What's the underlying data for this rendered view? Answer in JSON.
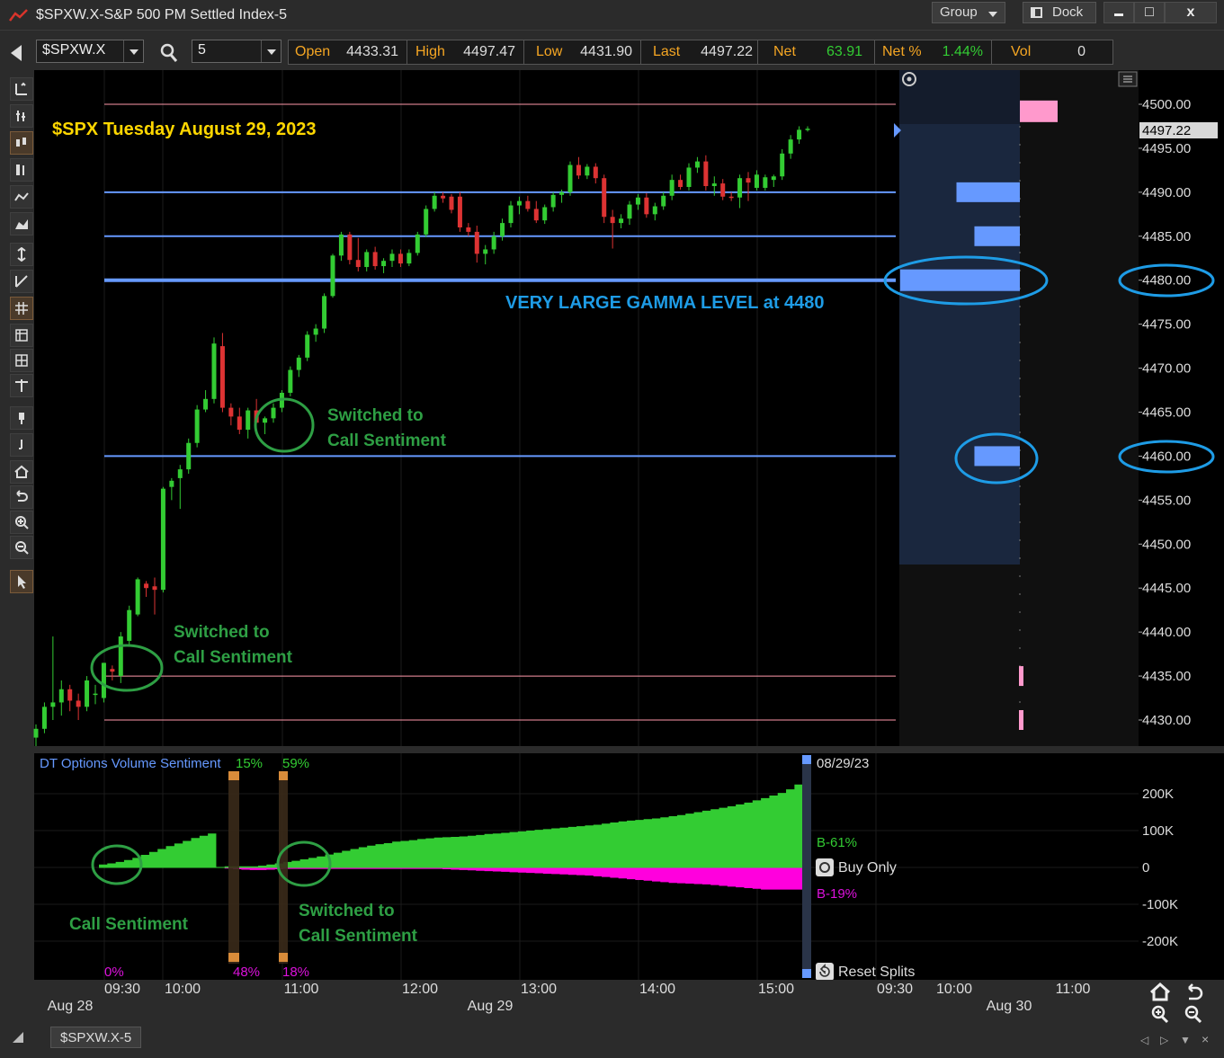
{
  "window": {
    "title": "$SPXW.X-S&P 500 PM Settled Index-5",
    "group_label": "Group",
    "dock_label": "Dock",
    "min_glyph": "▬",
    "max_glyph": "□",
    "close_glyph": "x"
  },
  "toolbar": {
    "symbol": "$SPXW.X",
    "interval": "5",
    "quote": [
      {
        "label": "Open",
        "value": "4433.31",
        "color": "#dddddd"
      },
      {
        "label": "High",
        "value": "4497.47",
        "color": "#dddddd"
      },
      {
        "label": "Low",
        "value": "4431.90",
        "color": "#dddddd"
      },
      {
        "label": "Last",
        "value": "4497.22",
        "color": "#dddddd"
      },
      {
        "label": "Net",
        "value": "63.91",
        "color": "#33cc33"
      },
      {
        "label": "Net %",
        "value": "1.44%",
        "color": "#33cc33"
      },
      {
        "label": "Vol",
        "value": "0",
        "color": "#dddddd"
      }
    ]
  },
  "footer": {
    "tab_label": "$SPXW.X-5"
  },
  "annotations": {
    "headline": "$SPX Tuesday August 29, 2023",
    "gamma_note": "VERY LARGE GAMMA LEVEL at 4480",
    "switch_upper": [
      "Switched to",
      "Call Sentiment"
    ],
    "switch_lower": [
      "Switched to",
      "Call Sentiment"
    ],
    "sentiment_start": "Call Sentiment",
    "sentiment_switch": [
      "Switched to",
      "Call Sentiment"
    ]
  },
  "price_axis": {
    "ticks": [
      "4500.00",
      "4495.00",
      "4490.00",
      "4485.00",
      "4480.00",
      "4475.00",
      "4470.00",
      "4465.00",
      "4460.00",
      "4455.00",
      "4450.00",
      "4445.00",
      "4440.00",
      "4435.00",
      "4430.00"
    ],
    "last_label": "4497.22"
  },
  "time_axis": {
    "times": [
      "09:30",
      "10:00",
      "11:00",
      "12:00",
      "13:00",
      "14:00",
      "15:00",
      "09:30",
      "10:00",
      "11:00"
    ],
    "dates": [
      "Aug 28",
      "Aug 29",
      "Aug 30"
    ]
  },
  "indicator": {
    "title": "DT Options Volume Sentiment",
    "top_pct_1": "15%",
    "top_pct_2": "59%",
    "bottom_pct_0": "0%",
    "bottom_pct_1": "48%",
    "bottom_pct_2": "18%",
    "date": "08/29/23",
    "buy_label": "B-61%",
    "sell_label": "B-19%",
    "buy_only": "Buy Only",
    "reset_splits": "Reset Splits",
    "axis": [
      "200K",
      "100K",
      "0",
      "-100K",
      "-200K"
    ]
  },
  "chart_data": [
    {
      "type": "candlestick",
      "title": "$SPX Tuesday August 29, 2023",
      "ylim": [
        4428,
        4503
      ],
      "gamma_levels": [
        4500,
        4490,
        4485,
        4480,
        4460,
        4435,
        4430
      ],
      "gamma_bars": [
        {
          "price": 4498,
          "size": 0.28,
          "color": "#ff99cc"
        },
        {
          "price": 4490,
          "size": 0.53,
          "color": "#6699ff"
        },
        {
          "price": 4485,
          "size": 0.38,
          "color": "#6699ff"
        },
        {
          "price": 4480,
          "size": 1.0,
          "color": "#6699ff"
        },
        {
          "price": 4460,
          "size": 0.38,
          "color": "#6699ff"
        },
        {
          "price": 4435,
          "size": 0.03,
          "color": "#ff99cc"
        },
        {
          "price": 4430,
          "size": 0.02,
          "color": "#ff99cc"
        }
      ],
      "candles": [
        [
          4428.0,
          4429.5,
          4427.0,
          4429.0
        ],
        [
          4429.0,
          4432.0,
          4428.5,
          4431.5
        ],
        [
          4431.5,
          4439.5,
          4430.0,
          4432.0
        ],
        [
          4432.0,
          4434.5,
          4430.5,
          4433.5
        ],
        [
          4433.5,
          4434.0,
          4431.0,
          4432.2
        ],
        [
          4432.2,
          4433.0,
          4430.0,
          4431.5
        ],
        [
          4431.5,
          4435.0,
          4431.0,
          4434.5
        ],
        [
          4433.0,
          4434.0,
          4431.8,
          4433.0
        ],
        [
          4432.5,
          4436.5,
          4432.0,
          4436.5
        ],
        [
          4435.8,
          4436.2,
          4434.5,
          4435.5
        ],
        [
          4435.0,
          4440.0,
          4434.2,
          4439.5
        ],
        [
          4439.0,
          4443.0,
          4438.5,
          4442.5
        ],
        [
          4442.0,
          4446.2,
          4441.8,
          4446.0
        ],
        [
          4445.5,
          4445.8,
          4444.0,
          4445.0
        ],
        [
          4445.2,
          4446.2,
          4442.0,
          4444.8
        ],
        [
          4444.8,
          4456.5,
          4444.5,
          4456.3
        ],
        [
          4456.5,
          4457.5,
          4455.0,
          4457.2
        ],
        [
          4457.5,
          4459.0,
          4454.0,
          4458.5
        ],
        [
          4458.5,
          4462.0,
          4458.0,
          4461.5
        ],
        [
          4461.5,
          4465.8,
          4461.0,
          4465.3
        ],
        [
          4465.3,
          4467.5,
          4465.0,
          4466.5
        ],
        [
          4466.5,
          4473.5,
          4466.0,
          4472.8
        ],
        [
          4472.5,
          4474.0,
          4465.0,
          4465.5
        ],
        [
          4465.5,
          4466.0,
          4463.5,
          4464.5
        ],
        [
          4464.5,
          4465.5,
          4462.5,
          4463.0
        ],
        [
          4463.0,
          4465.5,
          4462.0,
          4465.2
        ],
        [
          4465.2,
          4466.5,
          4463.8,
          4463.8
        ],
        [
          4463.8,
          4464.5,
          4462.5,
          4464.3
        ],
        [
          4464.3,
          4466.0,
          4463.8,
          4465.5
        ],
        [
          4465.5,
          4467.5,
          4465.0,
          4467.2
        ],
        [
          4467.2,
          4470.2,
          4466.8,
          4469.8
        ],
        [
          4469.8,
          4471.5,
          4469.0,
          4471.2
        ],
        [
          4471.2,
          4474.2,
          4470.8,
          4473.8
        ],
        [
          4473.8,
          4475.0,
          4473.0,
          4474.5
        ],
        [
          4474.5,
          4478.5,
          4474.0,
          4478.2
        ],
        [
          4478.2,
          4483.0,
          4478.0,
          4482.8
        ],
        [
          4482.8,
          4485.5,
          4482.2,
          4485.2
        ],
        [
          4485.2,
          4485.5,
          4481.8,
          4482.3
        ],
        [
          4482.3,
          4484.8,
          4481.0,
          4481.5
        ],
        [
          4481.5,
          4483.5,
          4481.0,
          4483.2
        ],
        [
          4483.2,
          4483.8,
          4481.2,
          4481.6
        ],
        [
          4481.6,
          4482.5,
          4480.8,
          4482.2
        ],
        [
          4482.2,
          4483.5,
          4481.5,
          4483.0
        ],
        [
          4483.0,
          4483.5,
          4481.5,
          4481.9
        ],
        [
          4481.9,
          4483.5,
          4481.6,
          4483.1
        ],
        [
          4483.1,
          4485.5,
          4482.8,
          4485.2
        ],
        [
          4485.2,
          4488.5,
          4484.9,
          4488.1
        ],
        [
          4488.1,
          4490.0,
          4487.8,
          4489.6
        ],
        [
          4489.6,
          4490.0,
          4488.8,
          4489.3
        ],
        [
          4489.5,
          4489.8,
          4487.6,
          4488.0
        ],
        [
          4489.5,
          4490.0,
          4485.5,
          4486.0
        ],
        [
          4486.0,
          4486.5,
          4485.0,
          4485.5
        ],
        [
          4485.5,
          4486.2,
          4482.0,
          4483.0
        ],
        [
          4483.0,
          4484.0,
          4481.8,
          4483.5
        ],
        [
          4483.5,
          4485.5,
          4483.0,
          4485.0
        ],
        [
          4485.0,
          4487.0,
          4484.5,
          4486.5
        ],
        [
          4486.5,
          4489.0,
          4486.0,
          4488.5
        ],
        [
          4488.5,
          4489.5,
          4487.5,
          4489.0
        ],
        [
          4489.0,
          4489.6,
          4487.8,
          4488.1
        ],
        [
          4488.1,
          4489.0,
          4486.5,
          4486.8
        ],
        [
          4486.8,
          4488.6,
          4486.4,
          4488.3
        ],
        [
          4488.3,
          4490.0,
          4487.8,
          4489.7
        ],
        [
          4489.7,
          4490.3,
          4488.8,
          4490.0
        ],
        [
          4490.0,
          4493.5,
          4489.6,
          4493.1
        ],
        [
          4493.1,
          4494.0,
          4491.5,
          4491.9
        ],
        [
          4491.9,
          4493.2,
          4491.5,
          4492.9
        ],
        [
          4492.9,
          4493.3,
          4491.0,
          4491.6
        ],
        [
          4491.6,
          4492.0,
          4486.5,
          4487.2
        ],
        [
          4487.2,
          4488.0,
          4483.6,
          4486.5
        ],
        [
          4486.5,
          4487.5,
          4485.9,
          4487.0
        ],
        [
          4487.0,
          4489.0,
          4486.3,
          4488.6
        ],
        [
          4488.6,
          4489.8,
          4488.0,
          4489.4
        ],
        [
          4489.4,
          4489.9,
          4487.1,
          4487.5
        ],
        [
          4487.5,
          4488.8,
          4486.8,
          4488.4
        ],
        [
          4488.4,
          4490.0,
          4488.0,
          4489.6
        ],
        [
          4489.6,
          4492.0,
          4489.1,
          4491.4
        ],
        [
          4491.4,
          4492.0,
          4490.3,
          4490.6
        ],
        [
          4490.6,
          4493.3,
          4490.2,
          4492.8
        ],
        [
          4492.8,
          4494.0,
          4492.2,
          4493.5
        ],
        [
          4493.5,
          4494.2,
          4490.2,
          4490.7
        ],
        [
          4490.7,
          4491.8,
          4489.6,
          4491.0
        ],
        [
          4491.0,
          4491.5,
          4489.1,
          4489.5
        ],
        [
          4489.5,
          4490.0,
          4489.0,
          4489.4
        ],
        [
          4489.4,
          4492.0,
          4488.2,
          4491.6
        ],
        [
          4491.6,
          4492.3,
          4489.0,
          4491.1
        ],
        [
          4490.5,
          4492.5,
          4490.2,
          4492.0
        ],
        [
          4490.5,
          4492.0,
          4490.2,
          4491.7
        ],
        [
          4491.4,
          4492.0,
          4490.6,
          4491.8
        ],
        [
          4491.8,
          4494.9,
          4491.4,
          4494.4
        ],
        [
          4494.4,
          4496.5,
          4493.8,
          4496.0
        ],
        [
          4496.0,
          4497.5,
          4495.5,
          4497.1
        ],
        [
          4497.1,
          4497.5,
          4496.9,
          4497.22
        ]
      ]
    },
    {
      "type": "area",
      "title": "DT Options Volume Sentiment",
      "ylim": [
        -270000,
        260000
      ],
      "buy_series": [
        8000,
        11000,
        15000,
        20000,
        26000,
        34000,
        42000,
        50000,
        58000,
        65000,
        72000,
        80000,
        86000,
        92000,
        0,
        3000,
        3000,
        3000,
        3000,
        5000,
        8000,
        11000,
        15000,
        18000,
        22000,
        26000,
        30000,
        35000,
        40000,
        45000,
        50000,
        55000,
        59000,
        63000,
        66000,
        70000,
        72000,
        74000,
        77000,
        79000,
        81000,
        82000,
        83000,
        84000,
        86000,
        88000,
        91000,
        92000,
        94000,
        96000,
        98000,
        100000,
        102000,
        104000,
        106000,
        108000,
        110000,
        112000,
        114000,
        116000,
        119000,
        122000,
        125000,
        127000,
        129000,
        131000,
        133000,
        136000,
        139000,
        142000,
        146000,
        150000,
        154000,
        158000,
        162000,
        166000,
        171000,
        176000,
        182000,
        188000,
        195000,
        202000,
        212000,
        225000,
        240000
      ],
      "sell_series": [
        0,
        0,
        0,
        0,
        0,
        0,
        0,
        0,
        0,
        0,
        0,
        0,
        0,
        0,
        -1000,
        -3000,
        -5000,
        -6000,
        -7000,
        -7000,
        -6000,
        -5000,
        -4000,
        -4000,
        -4000,
        -4000,
        -4000,
        -4000,
        -4000,
        -4000,
        -4000,
        -4000,
        -4000,
        -4000,
        -4000,
        -4000,
        -4000,
        -4000,
        -4000,
        -4000,
        -4000,
        -5000,
        -6000,
        -7000,
        -8000,
        -9000,
        -10000,
        -11000,
        -12000,
        -13000,
        -14000,
        -15000,
        -16000,
        -17000,
        -18000,
        -19000,
        -20000,
        -21000,
        -22000,
        -24000,
        -26000,
        -28000,
        -30000,
        -32000,
        -34000,
        -36000,
        -38000,
        -40000,
        -42000,
        -43000,
        -44000,
        -45000,
        -46000,
        -48000,
        -50000,
        -52000,
        -54000,
        -56000,
        -58000,
        -60000,
        -60000,
        -60000,
        -60000,
        -60000,
        -60000
      ]
    }
  ]
}
